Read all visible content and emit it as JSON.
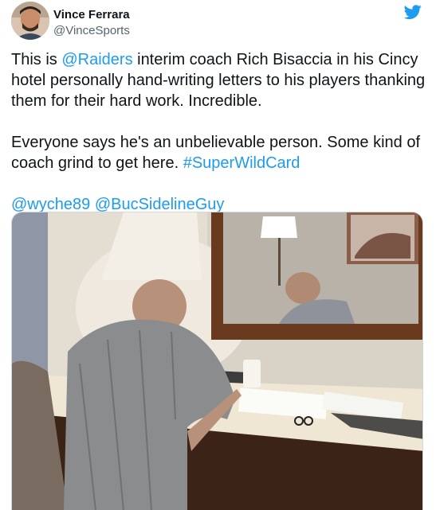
{
  "tweet": {
    "author_name": "Vince Ferrara",
    "author_handle": "@VinceSports",
    "line1": {
      "pre": "This is ",
      "mention": "@Raiders",
      "post": " interim coach Rich Bisaccia in his Cincy hotel personally hand-writing letters to his players thanking them for their hard work. Incredible."
    },
    "line2": {
      "pre": "Everyone says he's an unbelievable person. Some kind of coach grind to get here. ",
      "hashtag": "#SuperWildCard"
    },
    "mentions": [
      "@wyche89",
      "@BucSidelineGuy"
    ],
    "icons": {
      "brand": "twitter-bird-icon"
    },
    "colors": {
      "link": "#1d9bf0",
      "brand": "#1d9bf0",
      "text": "#0f1419",
      "secondary": "#536471"
    }
  }
}
